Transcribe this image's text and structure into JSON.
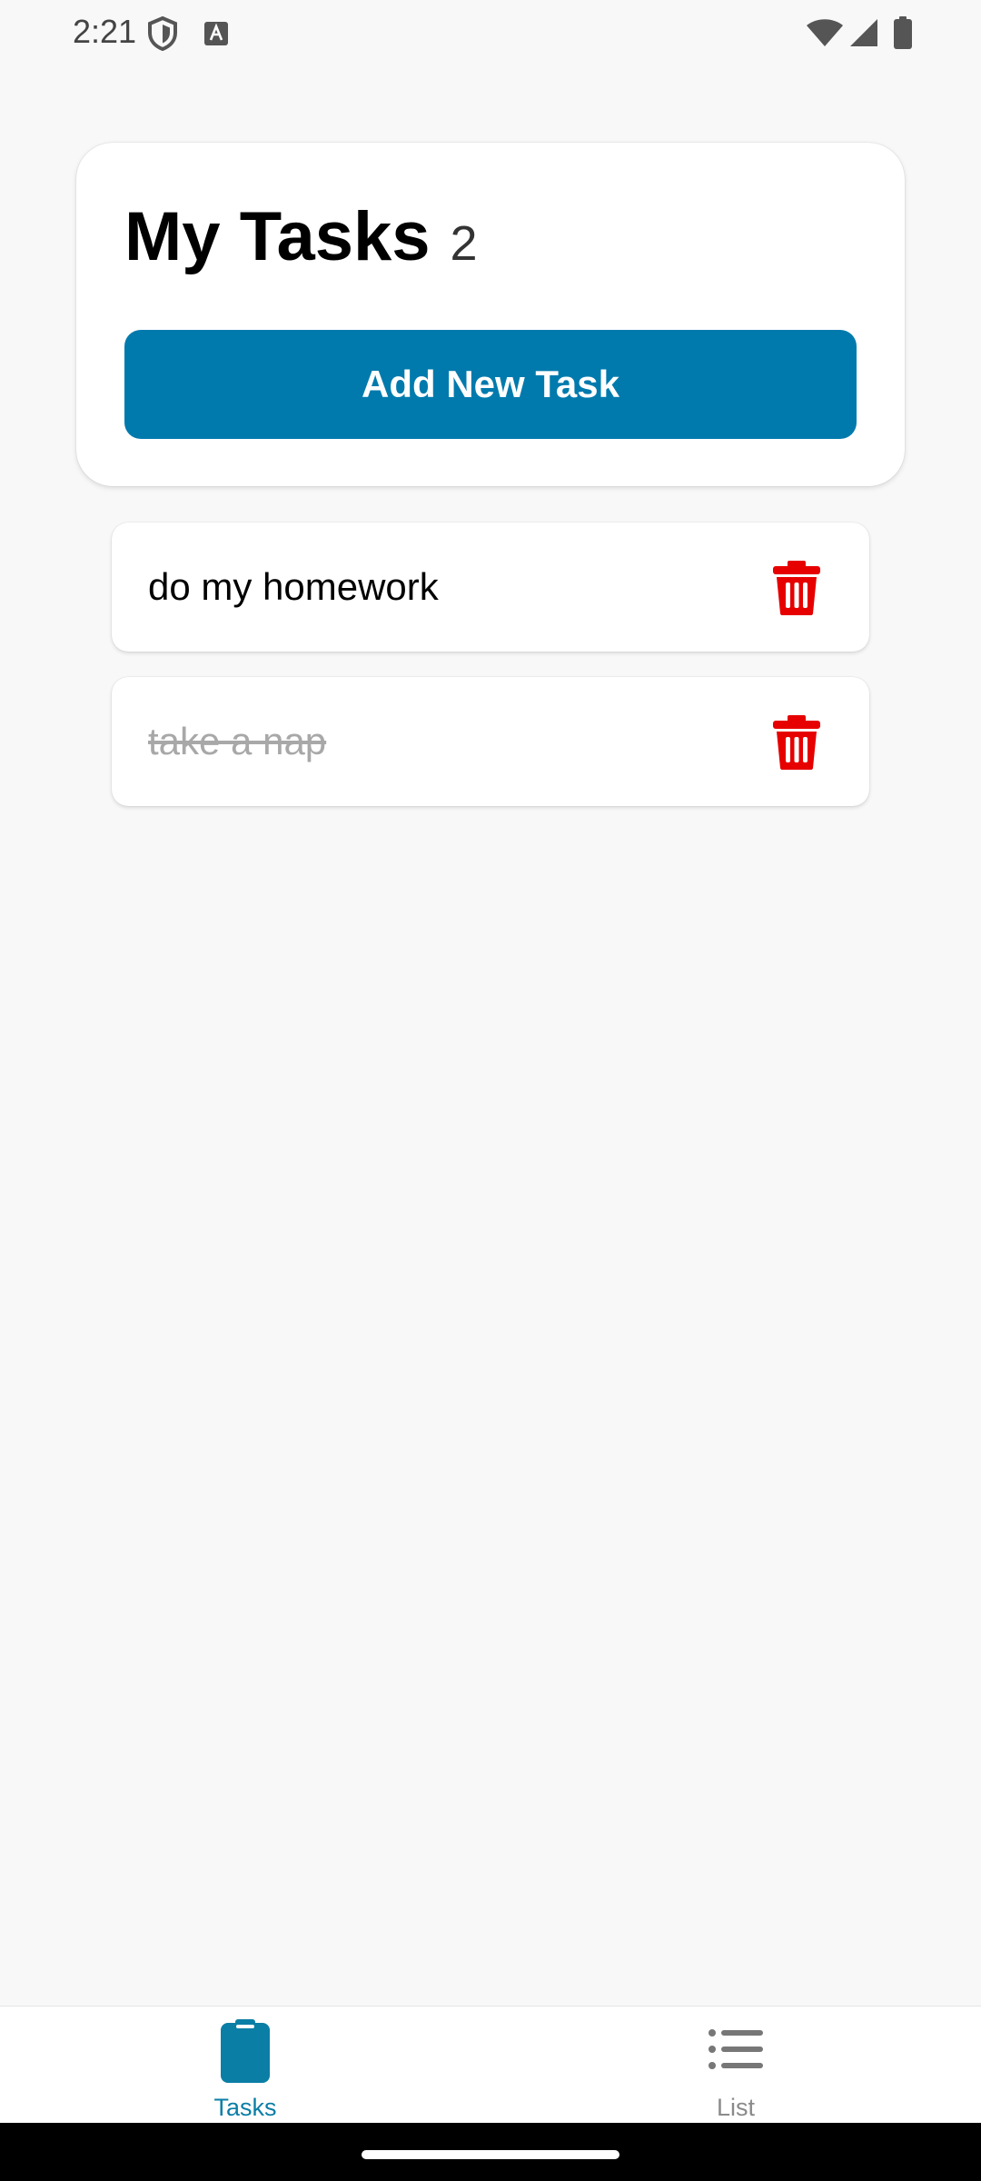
{
  "status_bar": {
    "time": "2:21",
    "icons": [
      "shield-icon",
      "keyboard-a-icon",
      "wifi-icon",
      "signal-icon",
      "battery-icon"
    ]
  },
  "header": {
    "title": "My Tasks",
    "count": "2",
    "add_button_label": "Add New Task"
  },
  "tasks": [
    {
      "text": "do my homework",
      "completed": false
    },
    {
      "text": "take a nap",
      "completed": true
    }
  ],
  "bottom_nav": {
    "tabs": [
      {
        "label": "Tasks",
        "icon": "clipboard-icon",
        "active": true
      },
      {
        "label": "List",
        "icon": "list-icon",
        "active": false
      }
    ]
  },
  "colors": {
    "accent": "#007aad",
    "delete": "#e60000",
    "completed_text": "#a8a8a8",
    "background": "#f8f8f8"
  }
}
